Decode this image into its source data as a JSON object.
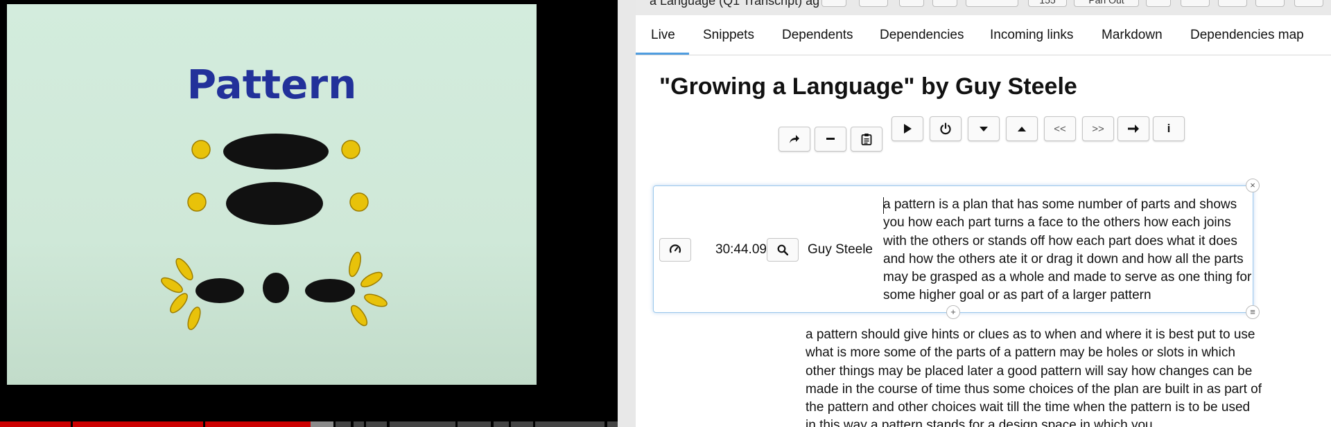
{
  "video": {
    "slide_title": "Pattern",
    "colors": {
      "slide_bg": "#d3ecdd",
      "title": "#22319a",
      "ellipse": "#111111",
      "dots": "#e8c20a",
      "played": "#cc0000",
      "buffered": "#8a8a8a",
      "unbuffered": "#444444"
    },
    "progress": {
      "played_fraction": 0.5
    }
  },
  "app": {
    "doc_title_partial": "a Language (Q1 Transcript) ag",
    "toolbar": {
      "counter": "155",
      "toggle_label": "Pan Out"
    },
    "tabs": [
      "Live",
      "Snippets",
      "Dependents",
      "Dependencies",
      "Incoming links",
      "Markdown",
      "Dependencies map"
    ],
    "active_tab": "Live",
    "page_title": "\"Growing a Language\" by Guy Steele",
    "controls": {
      "left_group": [
        "share-icon",
        "minus-icon",
        "clipboard-icon"
      ],
      "right_group": [
        "play-icon",
        "power-icon",
        "caret-down-icon",
        "caret-up-icon",
        "<<",
        ">>",
        "arrow-right-icon",
        "i"
      ]
    },
    "active_snippet": {
      "timestamp": "30:44.090s",
      "speaker": "Guy Steele",
      "text": "a pattern is a plan that has some number of parts and shows you how each part turns a face to the others how each joins with the others or stands off how each part does what it does and how the others ate it or drag it down and how all the parts may be grasped as a whole and made to serve as one thing for some higher goal or as part of a larger pattern",
      "close_glyph": "×",
      "add_glyph": "+",
      "menu_glyph": "≡"
    },
    "next_snippet": {
      "text": "a pattern should give hints or clues as to when and where it is best put to use what is more some of the parts of a pattern may be holes or slots in which other things may be placed later a good pattern will say how changes can be made in the course of time thus some choices of the plan are built in as part of the pattern and other choices wait till the time when the pattern is to be used in this way a pattern stands for a design space in which you"
    },
    "colors": {
      "accent": "#4f9de0",
      "card_border": "#9cc8ec"
    }
  }
}
